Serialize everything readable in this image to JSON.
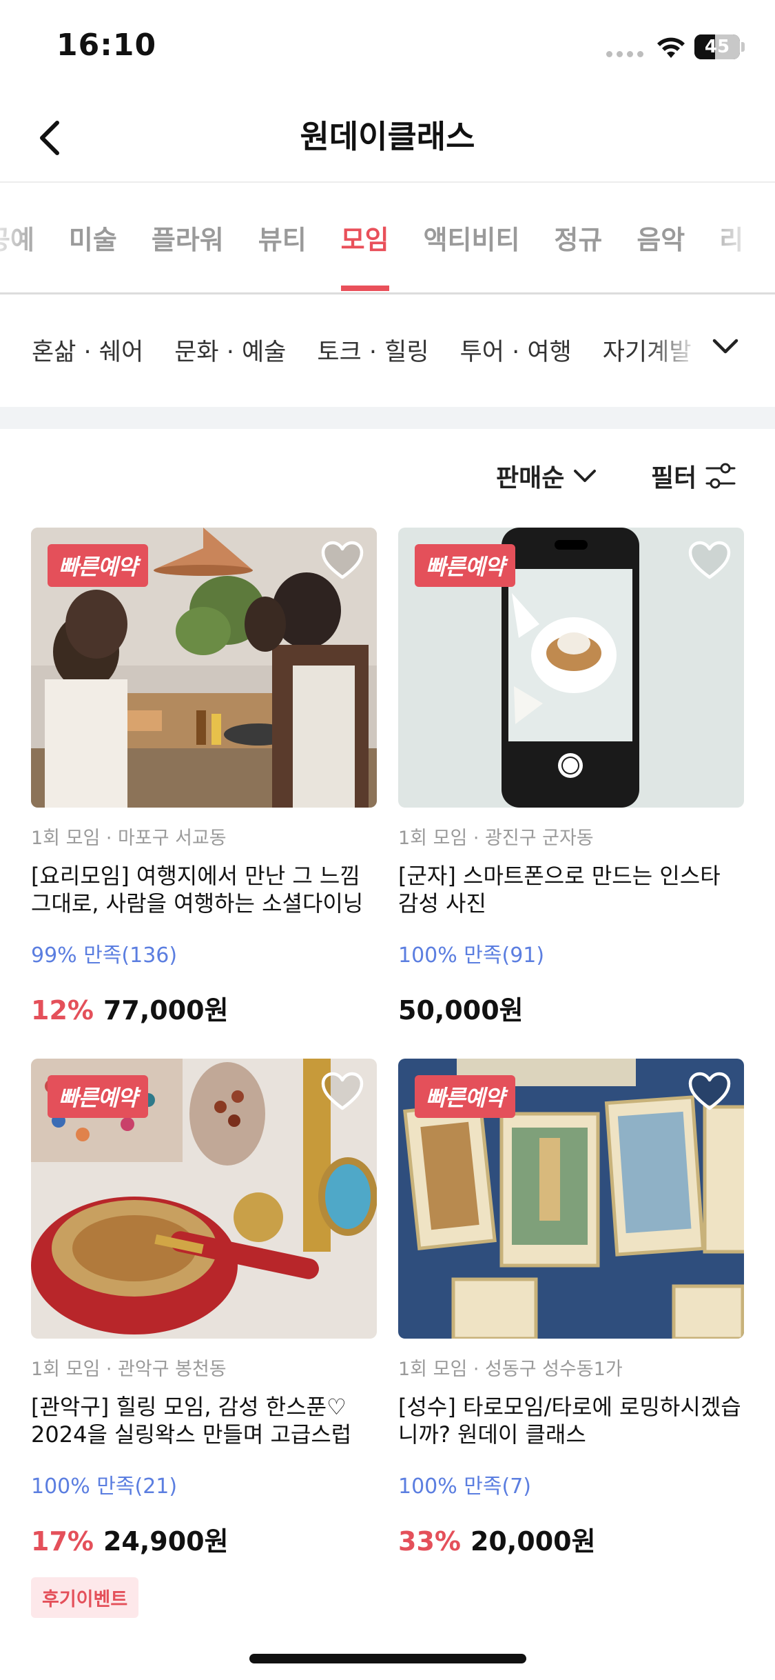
{
  "status_bar": {
    "time": "16:10",
    "battery": "45"
  },
  "header": {
    "title": "원데이클래스"
  },
  "category_tabs": [
    {
      "label": "공예",
      "active": false
    },
    {
      "label": "미술",
      "active": false
    },
    {
      "label": "플라워",
      "active": false
    },
    {
      "label": "뷰티",
      "active": false
    },
    {
      "label": "모임",
      "active": true
    },
    {
      "label": "액티비티",
      "active": false
    },
    {
      "label": "정규",
      "active": false
    },
    {
      "label": "음악",
      "active": false
    },
    {
      "label": "리",
      "active": false
    }
  ],
  "sub_categories": [
    "혼삶 · 쉐어",
    "문화 · 예술",
    "토크 · 힐링",
    "투어 · 여행",
    "자기계발"
  ],
  "toolbar": {
    "sort_label": "판매순",
    "filter_label": "필터"
  },
  "products": [
    {
      "badge": "빠른예약",
      "meta": "1회 모임 · 마포구 서교동",
      "title": "[요리모임] 여행지에서 만난 그 느낌 그대로, 사람을 여행하는 소셜다이닝",
      "rating": "99% 만족(136)",
      "discount": "12%",
      "price": "77,000원",
      "tag": ""
    },
    {
      "badge": "빠른예약",
      "meta": "1회 모임 · 광진구 군자동",
      "title": "[군자] 스마트폰으로 만드는 인스타 감성 사진",
      "rating": "100% 만족(91)",
      "discount": "",
      "price": "50,000원",
      "tag": ""
    },
    {
      "badge": "빠른예약",
      "meta": "1회 모임 · 관악구 봉천동",
      "title": "[관악구] 힐링 모임, 감성 한스푼♡ 2024을 실링왁스 만들며 고급스럽게!",
      "rating": "100% 만족(21)",
      "discount": "17%",
      "price": "24,900원",
      "tag": "후기이벤트"
    },
    {
      "badge": "빠른예약",
      "meta": "1회 모임 · 성동구 성수동1가",
      "title": "[성수] 타로모임/타로에 로밍하시겠습니까? 원데이 클래스",
      "rating": "100% 만족(7)",
      "discount": "33%",
      "price": "20,000원",
      "tag": ""
    }
  ],
  "colors": {
    "accent": "#e9505a",
    "rating": "#5b7ee0",
    "muted": "#9a9a9a"
  }
}
